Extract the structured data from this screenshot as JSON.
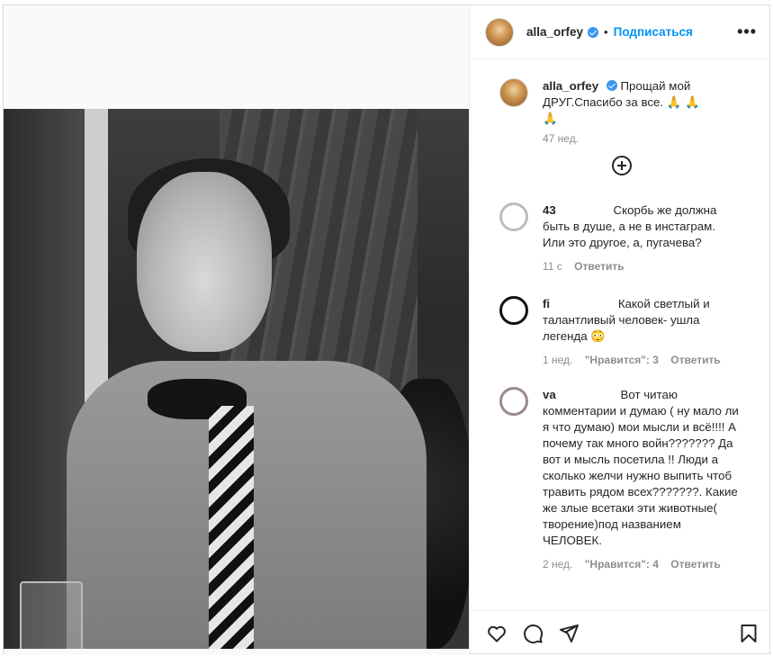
{
  "header": {
    "username": "alla_orfey",
    "dot": "•",
    "follow_label": "Подписаться",
    "more_label": "•••"
  },
  "caption": {
    "username": "alla_orfey",
    "text": "Прощай мой ДРУГ.Спасибо за все. 🙏 🙏 🙏",
    "time": "47 нед."
  },
  "comments": [
    {
      "username": "43",
      "text": "Скорбь же должна быть в душе, а не в инстаграм. Или это другое, а, пугачева?",
      "time": "11 с",
      "likes": "",
      "reply": "Ответить"
    },
    {
      "username": "fi",
      "text": "Какой светлый и талантливый человек- ушла легенда 😳",
      "time": "1 нед.",
      "likes": "\"Нравится\": 3",
      "reply": "Ответить"
    },
    {
      "username": "va",
      "text": "Вот читаю комментарии и думаю ( ну мало ли я что думаю) мои мысли и всё!!!! А почему так много войн??????? Да вот и мысль посетила !! Люди а сколько желчи нужно выпить чтоб травить рядом всех???????. Какие же злые всетаки эти животные( творение)под названием ЧЕЛОВЕК.",
      "time": "2 нед.",
      "likes": "\"Нравится\": 4",
      "reply": "Ответить"
    }
  ],
  "actions": [
    "heart-icon",
    "comment-icon",
    "share-icon",
    "bookmark-icon"
  ],
  "colors": {
    "link": "#0095f6",
    "verified": "#3897f0",
    "muted": "#8e8e8e"
  }
}
